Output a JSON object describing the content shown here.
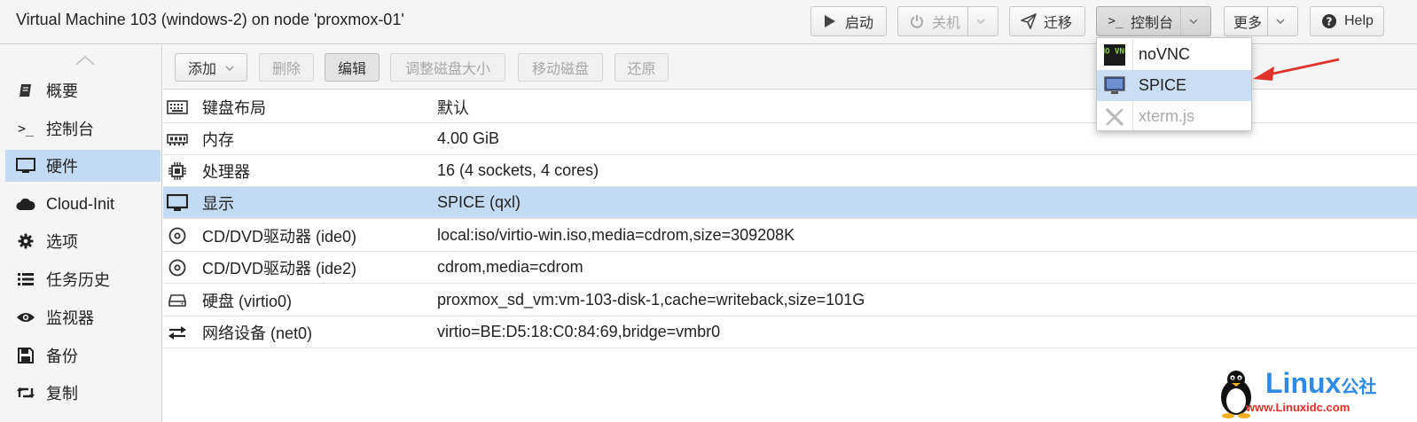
{
  "header": {
    "title": "Virtual Machine 103 (windows-2) on node 'proxmox-01'",
    "buttons": {
      "start": "启动",
      "shutdown": "关机",
      "migrate": "迁移",
      "console": "控制台",
      "more": "更多",
      "help": "Help"
    }
  },
  "console_menu": {
    "items": [
      {
        "label": "noVNC",
        "icon": "novnc-icon",
        "icon_text": "NO VNC",
        "state": "normal"
      },
      {
        "label": "SPICE",
        "icon": "monitor-icon",
        "state": "highlighted"
      },
      {
        "label": "xterm.js",
        "icon": "xterm-icon",
        "state": "disabled"
      }
    ]
  },
  "sidebar": {
    "items": [
      {
        "label": "概要",
        "icon": "book-icon"
      },
      {
        "label": "控制台",
        "icon": "terminal-icon"
      },
      {
        "label": "硬件",
        "icon": "monitor-icon",
        "selected": true
      },
      {
        "label": "Cloud-Init",
        "icon": "cloud-icon"
      },
      {
        "label": "选项",
        "icon": "gear-icon"
      },
      {
        "label": "任务历史",
        "icon": "list-icon"
      },
      {
        "label": "监视器",
        "icon": "eye-icon"
      },
      {
        "label": "备份",
        "icon": "floppy-icon"
      },
      {
        "label": "复制",
        "icon": "retweet-icon"
      }
    ]
  },
  "hardware_toolbar": {
    "add": "添加",
    "remove": "删除",
    "edit": "编辑",
    "resize_disk": "调整磁盘大小",
    "move_disk": "移动磁盘",
    "revert": "还原"
  },
  "hardware": {
    "rows": [
      {
        "name": "键盘布局",
        "value": "默认",
        "icon": "keyboard-icon"
      },
      {
        "name": "内存",
        "value": "4.00 GiB",
        "icon": "memory-icon"
      },
      {
        "name": "处理器",
        "value": "16 (4 sockets, 4 cores)",
        "icon": "cpu-icon"
      },
      {
        "name": "显示",
        "value": "SPICE (qxl)",
        "icon": "monitor-icon",
        "selected": true
      },
      {
        "name": "CD/DVD驱动器 (ide0)",
        "value": "local:iso/virtio-win.iso,media=cdrom,size=309208K",
        "icon": "cdrom-icon"
      },
      {
        "name": "CD/DVD驱动器 (ide2)",
        "value": "cdrom,media=cdrom",
        "icon": "cdrom-icon"
      },
      {
        "name": "硬盘 (virtio0)",
        "value": "proxmox_sd_vm:vm-103-disk-1,cache=writeback,size=101G",
        "icon": "harddisk-icon"
      },
      {
        "name": "网络设备 (net0)",
        "value": "virtio=BE:D5:18:C0:84:69,bridge=vmbr0",
        "icon": "exchange-icon"
      }
    ]
  },
  "watermark": {
    "brand": "Linux",
    "brand_suffix": "公社",
    "url": "www.Linuxidc.com"
  },
  "colors": {
    "selection": "#c3dbf2",
    "annotation_arrow": "#e0322a",
    "watermark_blue": "#2f8ae3"
  }
}
